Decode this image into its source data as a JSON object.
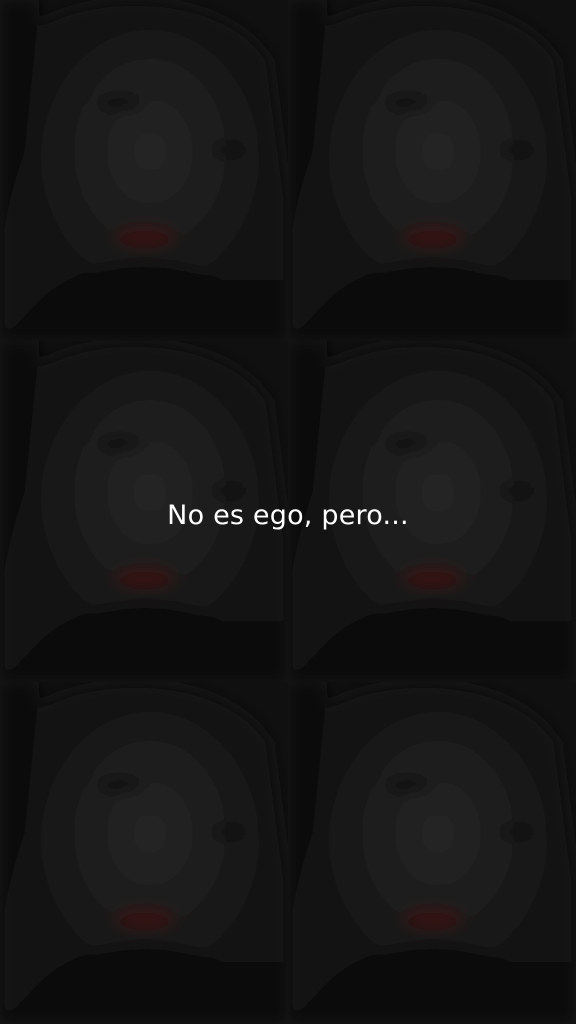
{
  "story": {
    "caption": "No es ego, pero...",
    "background": {
      "layout": "2x3 repeated dark selfie photo grid",
      "tile_count": 6
    }
  },
  "colors": {
    "background": "#0c0c0c",
    "caption_text": "#ffffff",
    "lip_tint": "#3a1416"
  }
}
